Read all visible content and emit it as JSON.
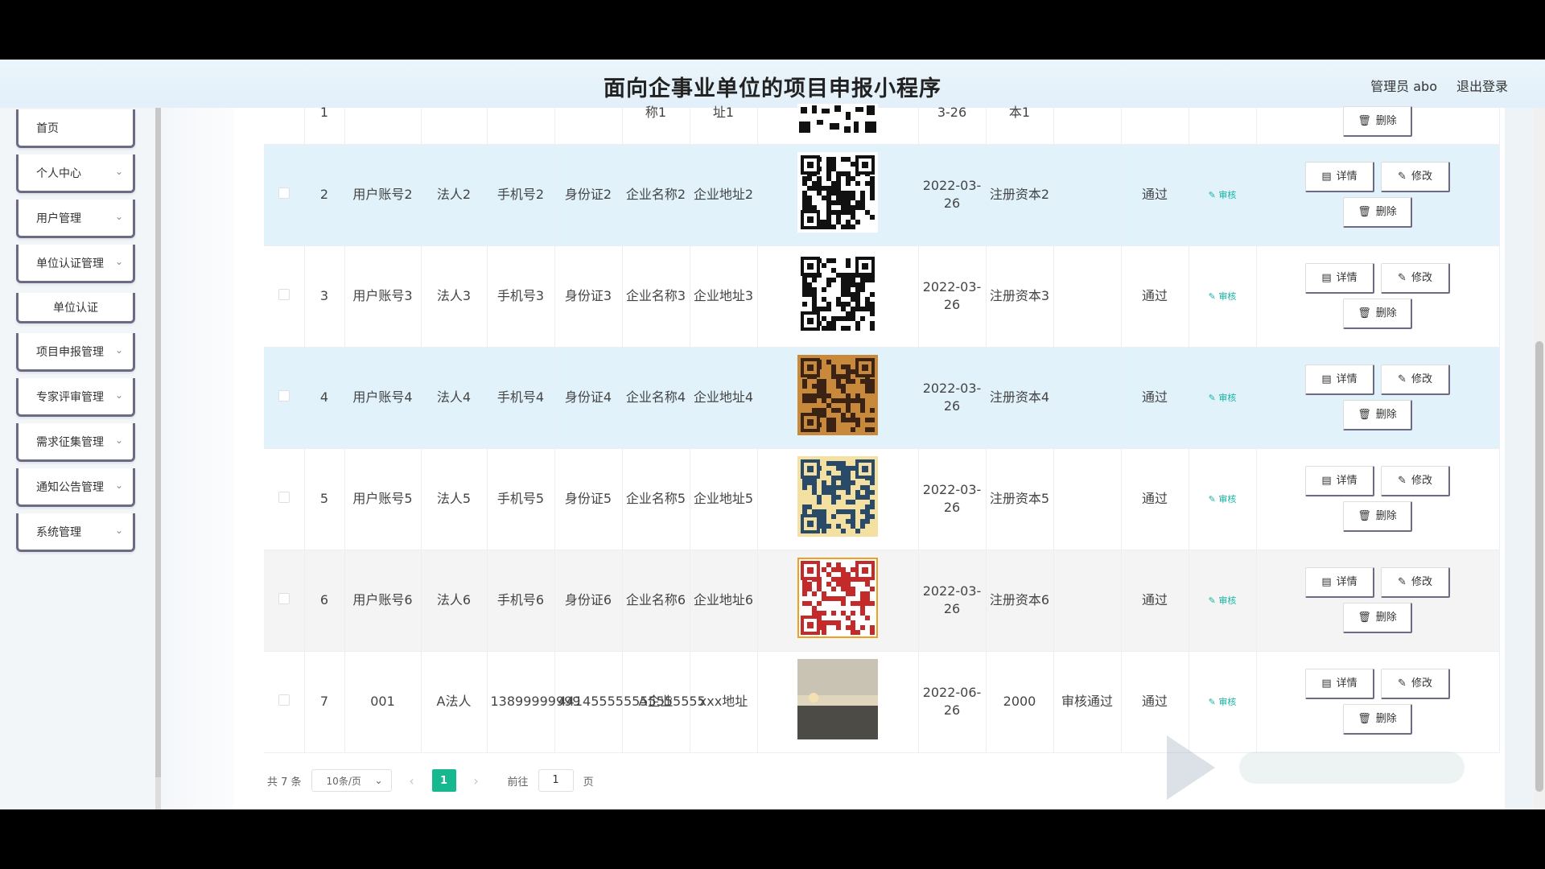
{
  "header": {
    "title": "面向企事业单位的项目申报小程序",
    "admin_label": "管理员 abo",
    "logout_label": "退出登录"
  },
  "sidebar": {
    "items": [
      {
        "label": "首页",
        "has_children": false
      },
      {
        "label": "个人中心",
        "has_children": true
      },
      {
        "label": "用户管理",
        "has_children": true
      },
      {
        "label": "单位认证管理",
        "has_children": true
      },
      {
        "label": "单位认证",
        "has_children": false,
        "sub": true
      },
      {
        "label": "项目申报管理",
        "has_children": true
      },
      {
        "label": "专家评审管理",
        "has_children": true
      },
      {
        "label": "需求征集管理",
        "has_children": true
      },
      {
        "label": "通知公告管理",
        "has_children": true
      },
      {
        "label": "系统管理",
        "has_children": true
      }
    ]
  },
  "table": {
    "top_partial": {
      "index": "1",
      "name": "称1",
      "addr": "址1",
      "date": "3-26",
      "capital": "本1",
      "delete": "删除"
    },
    "rows": [
      {
        "index": "2",
        "account": "用户账号2",
        "legal": "法人2",
        "phone": "手机号2",
        "idcard": "身份证2",
        "company": "企业名称2",
        "address": "企业地址2",
        "date": "2022-03-26",
        "capital": "注册资本2",
        "reply": "",
        "status": "通过",
        "qr": "qr-a"
      },
      {
        "index": "3",
        "account": "用户账号3",
        "legal": "法人3",
        "phone": "手机号3",
        "idcard": "身份证3",
        "company": "企业名称3",
        "address": "企业地址3",
        "date": "2022-03-26",
        "capital": "注册资本3",
        "reply": "",
        "status": "通过",
        "qr": "qr-b"
      },
      {
        "index": "4",
        "account": "用户账号4",
        "legal": "法人4",
        "phone": "手机号4",
        "idcard": "身份证4",
        "company": "企业名称4",
        "address": "企业地址4",
        "date": "2022-03-26",
        "capital": "注册资本4",
        "reply": "",
        "status": "通过",
        "qr": "qr-c"
      },
      {
        "index": "5",
        "account": "用户账号5",
        "legal": "法人5",
        "phone": "手机号5",
        "idcard": "身份证5",
        "company": "企业名称5",
        "address": "企业地址5",
        "date": "2022-03-26",
        "capital": "注册资本5",
        "reply": "",
        "status": "通过",
        "qr": "qr-d"
      },
      {
        "index": "6",
        "account": "用户账号6",
        "legal": "法人6",
        "phone": "手机号6",
        "idcard": "身份证6",
        "company": "企业名称6",
        "address": "企业地址6",
        "date": "2022-03-26",
        "capital": "注册资本6",
        "reply": "",
        "status": "通过",
        "qr": "qr-e"
      },
      {
        "index": "7",
        "account": "001",
        "legal": "A法人",
        "phone": "13899999999",
        "idcard": "441455555555555555",
        "company": "A企业",
        "address": "xxx地址",
        "date": "2022-06-26",
        "capital": "2000",
        "reply": "审核通过",
        "status": "通过",
        "qr": "photo"
      }
    ],
    "audit_label": "审核",
    "detail_label": "详情",
    "edit_label": "修改",
    "delete_label": "删除"
  },
  "pagination": {
    "total": "共 7 条",
    "page_size": "10条/页",
    "current": "1",
    "goto_prefix": "前往",
    "goto_value": "1",
    "goto_suffix": "页"
  },
  "colors": {
    "accent": "#17b890",
    "stripe": "#e1f2fb",
    "audit": "#17b3a3"
  }
}
